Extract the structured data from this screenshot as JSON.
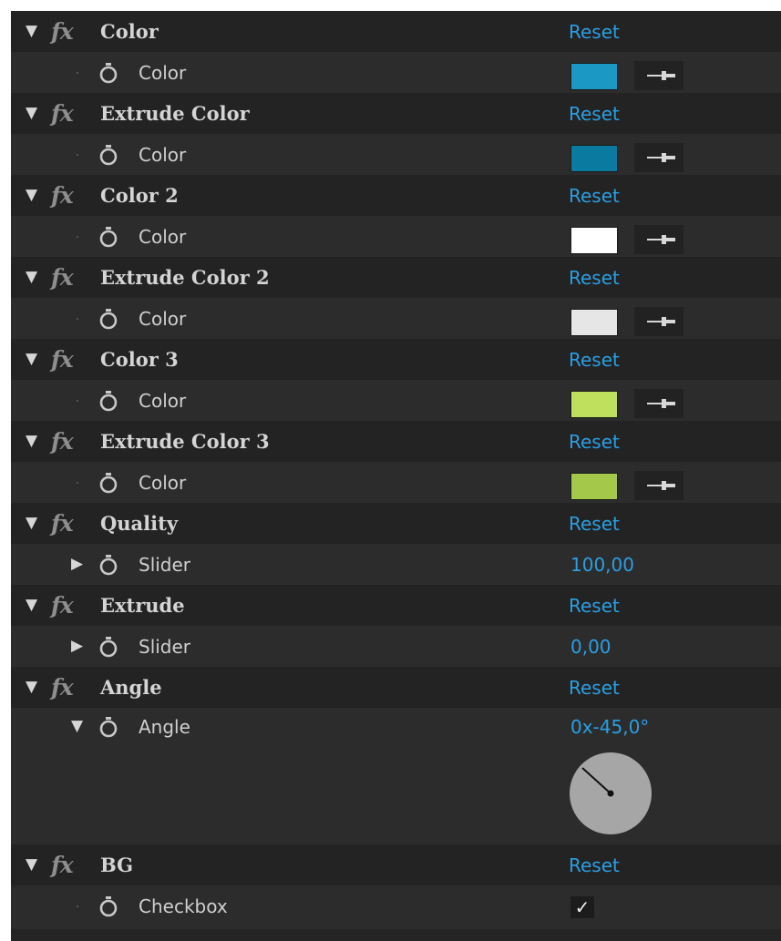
{
  "reset_label": "Reset",
  "effects": [
    {
      "name": "Color",
      "param": {
        "name": "Color",
        "color": "#1b98c4"
      }
    },
    {
      "name": "Extrude Color",
      "param": {
        "name": "Color",
        "color": "#0a7aa0"
      }
    },
    {
      "name": "Color 2",
      "param": {
        "name": "Color",
        "color": "#ffffff"
      }
    },
    {
      "name": "Extrude Color 2",
      "param": {
        "name": "Color",
        "color": "#e6e6e6"
      }
    },
    {
      "name": "Color 3",
      "param": {
        "name": "Color",
        "color": "#bfe05d"
      }
    },
    {
      "name": "Extrude Color 3",
      "param": {
        "name": "Color",
        "color": "#a3c84a"
      }
    },
    {
      "name": "Quality",
      "param": {
        "name": "Slider",
        "value": "100,00"
      }
    },
    {
      "name": "Extrude",
      "param": {
        "name": "Slider",
        "value": "0,00"
      }
    },
    {
      "name": "Angle",
      "param": {
        "name": "Angle",
        "value": "0x-45,0°"
      }
    },
    {
      "name": "BG",
      "param": {
        "name": "Checkbox",
        "checked_mark": "✓"
      }
    }
  ],
  "icons": {
    "twirl_open": "triangle-down-icon",
    "twirl_closed": "triangle-right-icon",
    "fx": "fx-icon",
    "stopwatch": "stopwatch-icon",
    "eyedropper": "eyedropper-icon"
  },
  "fx_glyph": "fx",
  "twirl_open_glyph": "▼",
  "twirl_closed_glyph": "▶",
  "accent_color": "#2a9fe3"
}
